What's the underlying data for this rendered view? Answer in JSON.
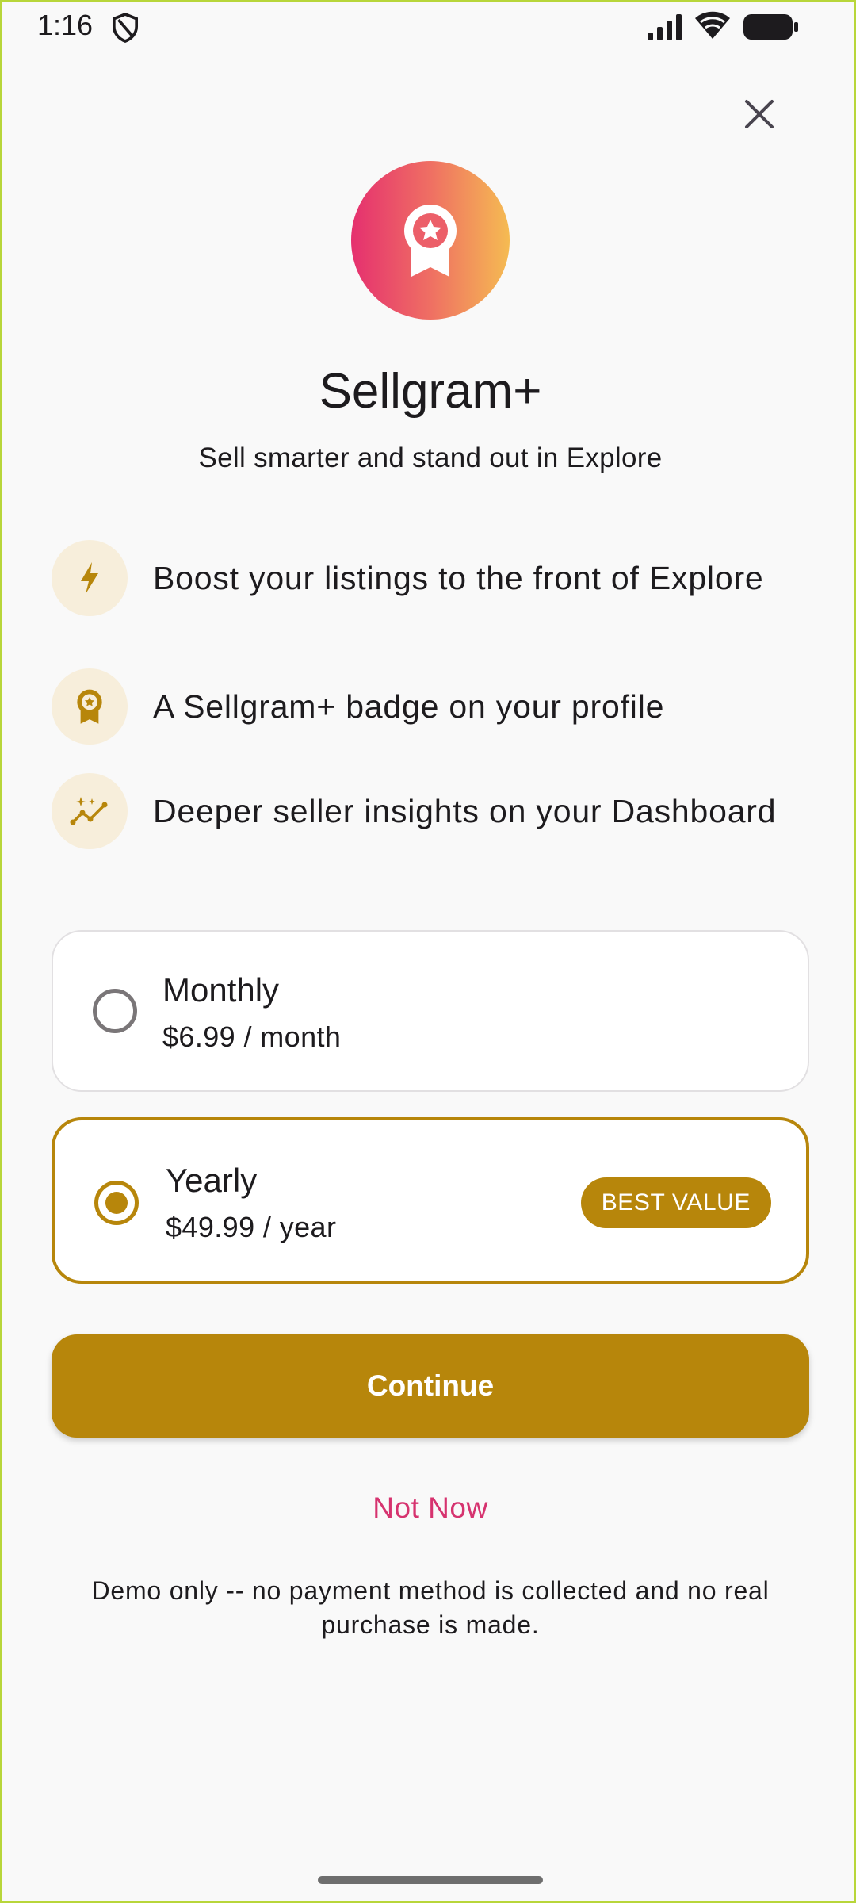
{
  "status_bar": {
    "time": "1:16",
    "icons": [
      "shield-icon",
      "signal-icon",
      "wifi-icon",
      "battery-icon"
    ]
  },
  "header": {
    "close_icon": "close-icon",
    "badge_icon": "award-ribbon-icon",
    "title": "Sellgram+",
    "subtitle": "Sell smarter and stand out in Explore"
  },
  "features": [
    {
      "icon": "lightning-bolt-icon",
      "text": "Boost your listings to the front of Explore"
    },
    {
      "icon": "award-ribbon-icon",
      "text": "A Sellgram+ badge on your profile"
    },
    {
      "icon": "insights-chart-icon",
      "text": "Deeper seller insights on your Dashboard"
    }
  ],
  "plans": [
    {
      "name": "Monthly",
      "price": "$6.99 / month",
      "selected": false
    },
    {
      "name": "Yearly",
      "price": "$49.99 / year",
      "selected": true,
      "badge": "BEST VALUE"
    }
  ],
  "actions": {
    "continue_label": "Continue",
    "not_now_label": "Not Now"
  },
  "disclaimer": "Demo only -- no payment method is collected and no real purchase is made.",
  "colors": {
    "accent": "#b7860b",
    "accent_light": "#f7eedb",
    "link": "#d6336f",
    "gradient_start": "#e5306f",
    "gradient_end": "#f5bb52",
    "background": "#f9f9f9"
  }
}
